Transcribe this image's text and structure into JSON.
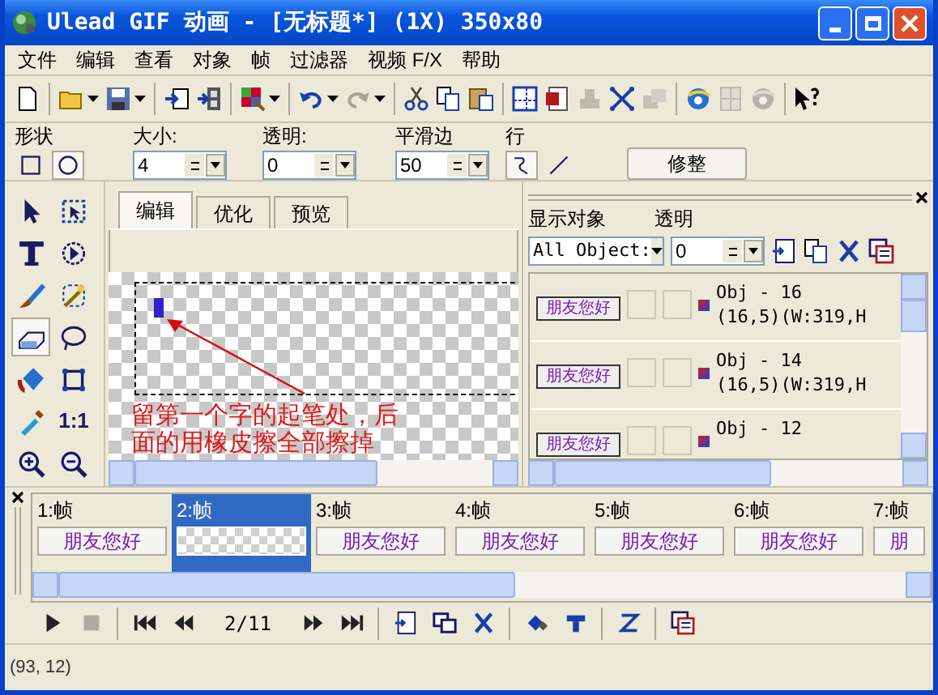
{
  "window": {
    "title": "Ulead GIF 动画 - [无标题*] (1X) 350x80"
  },
  "menu": [
    "文件",
    "编辑",
    "查看",
    "对象",
    "帧",
    "过滤器",
    "视频 F/X",
    "帮助"
  ],
  "toolbar_groups": [
    {
      "buttons": [
        {
          "kind": "new",
          "disabled": false,
          "dropdown": false
        }
      ]
    },
    {
      "buttons": [
        {
          "kind": "open",
          "disabled": false,
          "dropdown": true
        },
        {
          "kind": "save",
          "disabled": false,
          "dropdown": true
        }
      ]
    },
    {
      "buttons": [
        {
          "kind": "import",
          "disabled": false,
          "dropdown": false
        },
        {
          "kind": "film",
          "disabled": false,
          "dropdown": false
        }
      ]
    },
    {
      "buttons": [
        {
          "kind": "palette",
          "disabled": false,
          "dropdown": true
        }
      ]
    },
    {
      "buttons": [
        {
          "kind": "undo",
          "disabled": false,
          "dropdown": true
        },
        {
          "kind": "redo",
          "disabled": true,
          "dropdown": true
        }
      ]
    },
    {
      "buttons": [
        {
          "kind": "cut",
          "disabled": false,
          "dropdown": false
        },
        {
          "kind": "copy",
          "disabled": false,
          "dropdown": false
        },
        {
          "kind": "paste",
          "disabled": false,
          "dropdown": false
        }
      ]
    },
    {
      "buttons": [
        {
          "kind": "frame",
          "disabled": false,
          "dropdown": false
        },
        {
          "kind": "gif",
          "disabled": false,
          "dropdown": false
        },
        {
          "kind": "stamp",
          "disabled": true,
          "dropdown": false
        },
        {
          "kind": "explode",
          "disabled": false,
          "dropdown": false
        },
        {
          "kind": "merge",
          "disabled": true,
          "dropdown": false
        }
      ]
    },
    {
      "buttons": [
        {
          "kind": "globe",
          "disabled": false,
          "dropdown": false
        },
        {
          "kind": "page",
          "disabled": true,
          "dropdown": false
        },
        {
          "kind": "globe",
          "disabled": true,
          "dropdown": false
        }
      ]
    },
    {
      "buttons": [
        {
          "kind": "help",
          "disabled": false,
          "dropdown": false
        }
      ]
    }
  ],
  "properties": {
    "shape": {
      "label": "形状",
      "options": [
        {
          "kind": "square",
          "selected": false
        },
        {
          "kind": "circle",
          "selected": true
        }
      ]
    },
    "size": {
      "label": "大小:",
      "value": "4"
    },
    "opacity": {
      "label": "透明:",
      "value": "0"
    },
    "smooth": {
      "label": "平滑边",
      "value": "50"
    },
    "line": {
      "label": "行",
      "options": [
        {
          "kind": "curve",
          "selected": true
        },
        {
          "kind": "straight",
          "selected": false
        }
      ]
    },
    "button": "修整"
  },
  "tools": [
    {
      "kind": "pointer",
      "selected": false
    },
    {
      "kind": "marquee",
      "selected": false
    },
    {
      "kind": "text",
      "selected": false
    },
    {
      "kind": "transform",
      "selected": false
    },
    {
      "kind": "brush",
      "selected": false
    },
    {
      "kind": "wand",
      "selected": false
    },
    {
      "kind": "eraser",
      "selected": true
    },
    {
      "kind": "lasso",
      "selected": false
    },
    {
      "kind": "fill",
      "selected": false
    },
    {
      "kind": "crop",
      "selected": false
    },
    {
      "kind": "dropper",
      "selected": false
    },
    {
      "kind": "actual_size",
      "label": "1:1",
      "selected": false
    },
    {
      "kind": "zoom_in",
      "selected": false
    },
    {
      "kind": "zoom_out",
      "selected": false
    }
  ],
  "tabs": [
    {
      "label": "编辑",
      "selected": true
    },
    {
      "label": "优化",
      "selected": false
    },
    {
      "label": "预览",
      "selected": false
    }
  ],
  "canvas": {
    "annotation": "留第一个字的起笔处，后面的用橡皮擦全部擦掉"
  },
  "objects_panel": {
    "show_label": "显示对象",
    "show_value": "All Object:",
    "opacity_label": "透明",
    "opacity_value": "0",
    "rows": [
      {
        "thumbnail_text": "朋友您好",
        "visible": false,
        "locked": false,
        "name": "Obj - 16",
        "geometry": "(16,5)(W:319,H"
      },
      {
        "thumbnail_text": "朋友您好",
        "visible": false,
        "locked": false,
        "name": "Obj - 14",
        "geometry": "(16,5)(W:319,H"
      },
      {
        "thumbnail_text": "朋友您好",
        "visible": false,
        "locked": false,
        "name": "Obj - 12"
      }
    ]
  },
  "frames": [
    {
      "label": "1:帧",
      "thumbnail_text": "朋友您好",
      "selected": false
    },
    {
      "label": "2:帧",
      "selected": true
    },
    {
      "label": "3:帧",
      "thumbnail_text": "朋友您好",
      "selected": false
    },
    {
      "label": "4:帧",
      "thumbnail_text": "朋友您好",
      "selected": false
    },
    {
      "label": "5:帧",
      "thumbnail_text": "朋友您好",
      "selected": false
    },
    {
      "label": "6:帧",
      "thumbnail_text": "朋友您好",
      "selected": false
    },
    {
      "label": "7:帧",
      "thumbnail_text": "朋",
      "selected": false
    }
  ],
  "playback": [
    [
      {
        "kind": "play",
        "disabled": false
      },
      {
        "kind": "stop",
        "disabled": true
      }
    ],
    [
      {
        "kind": "first",
        "disabled": false
      },
      {
        "kind": "prev",
        "disabled": false
      },
      {
        "kind": "counter",
        "text": "2/11"
      },
      {
        "kind": "next",
        "disabled": false
      },
      {
        "kind": "last",
        "disabled": false
      }
    ],
    [
      {
        "kind": "add_frame",
        "disabled": false
      },
      {
        "kind": "duplicate",
        "disabled": false
      },
      {
        "kind": "delete",
        "disabled": false
      }
    ],
    [
      {
        "kind": "tween",
        "disabled": false
      },
      {
        "kind": "banner",
        "disabled": false
      }
    ],
    [
      {
        "kind": "reverse",
        "disabled": false
      }
    ],
    [
      {
        "kind": "frame_props",
        "disabled": false
      }
    ]
  ],
  "status_bar": "(93, 12)"
}
